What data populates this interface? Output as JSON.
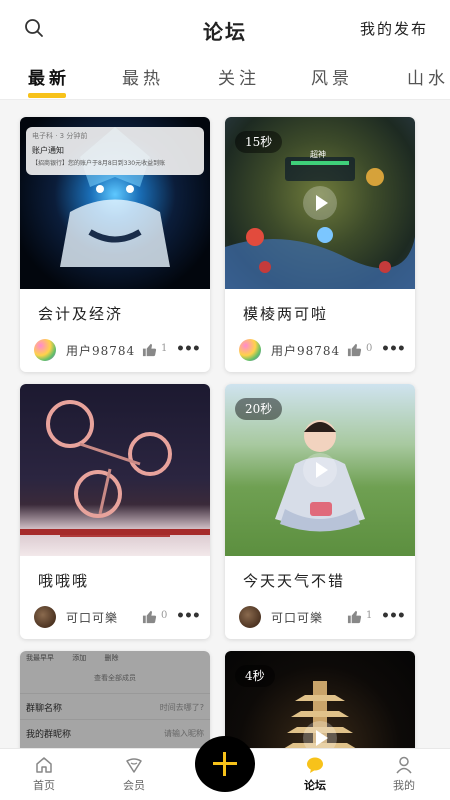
{
  "header": {
    "title": "论坛",
    "my_posts": "我的发布"
  },
  "icons": {
    "search": "search-icon",
    "like": "thumbs-up-icon",
    "more": "more-icon"
  },
  "tabs": [
    {
      "label": "最新",
      "active": true
    },
    {
      "label": "最热"
    },
    {
      "label": "关注"
    },
    {
      "label": "风景"
    },
    {
      "label": "山水"
    }
  ],
  "posts": [
    {
      "title": "会计及经济",
      "author": "用户98784",
      "likes": "1",
      "more": "•••",
      "thumb": {
        "notif_app": "电子科 · 3 分钟前",
        "notif_title": "账户通知",
        "notif_body": "【招商银行】您的账户于8月8日到330元收益到账"
      }
    },
    {
      "title": "模棱两可啦",
      "author": "用户98784",
      "likes": "0",
      "more": "•••",
      "duration": "15秒",
      "thumb": {
        "game_hud_name": "超神"
      }
    },
    {
      "title": "哦哦哦",
      "author": "可口可樂",
      "likes": "0",
      "more": "•••"
    },
    {
      "title": "今天天气不错",
      "author": "可口可樂",
      "likes": "1",
      "more": "•••",
      "duration": "20秒"
    },
    {
      "title": "",
      "thumb": {
        "group_header": [
          "我最早早",
          "添加",
          "删除"
        ],
        "view_all": "查看全部成员",
        "rows": [
          {
            "label": "群聊名称",
            "value": "时间去哪了?"
          },
          {
            "label": "我的群昵称",
            "value": "请输入昵称"
          }
        ]
      }
    },
    {
      "title": "",
      "duration": "4秒"
    }
  ],
  "nav": [
    {
      "label": "首页",
      "icon": "home-icon"
    },
    {
      "label": "会员",
      "icon": "vip-icon"
    },
    {
      "label": "论坛",
      "icon": "forum-icon",
      "active": true
    },
    {
      "label": "我的",
      "icon": "profile-icon"
    }
  ],
  "colors": {
    "accent": "#f7c21a",
    "fab": "#000000"
  }
}
